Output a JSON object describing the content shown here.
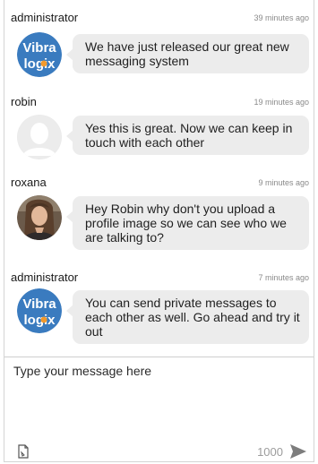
{
  "messages": [
    {
      "user": "administrator",
      "time": "39 minutes ago",
      "text": "We have just released our great new messaging system",
      "avatar": {
        "type": "logo",
        "line1": "Vibra",
        "line2": "logix",
        "bg": "#3a7bbf",
        "accent": "#f29a2e"
      }
    },
    {
      "user": "robin",
      "time": "19 minutes ago",
      "text": "Yes this is great. Now we can keep in touch with each other",
      "avatar": {
        "type": "default"
      }
    },
    {
      "user": "roxana",
      "time": "9 minutes ago",
      "text": "Hey Robin why don't you upload a profile image so we can see who we are talking to?",
      "avatar": {
        "type": "photo"
      }
    },
    {
      "user": "administrator",
      "time": "7 minutes ago",
      "text": "You can send private messages to each other as well. Go ahead and try it out",
      "avatar": {
        "type": "logo",
        "line1": "Vibra",
        "line2": "logix",
        "bg": "#3a7bbf",
        "accent": "#f29a2e"
      }
    }
  ],
  "composer": {
    "placeholder": "Type your message here",
    "char_limit": "1000",
    "attach_icon": "attachment-icon",
    "send_icon": "send-icon"
  },
  "colors": {
    "bubble": "#ececec",
    "time": "#8a8a8a",
    "counter": "#9c9c9c"
  }
}
